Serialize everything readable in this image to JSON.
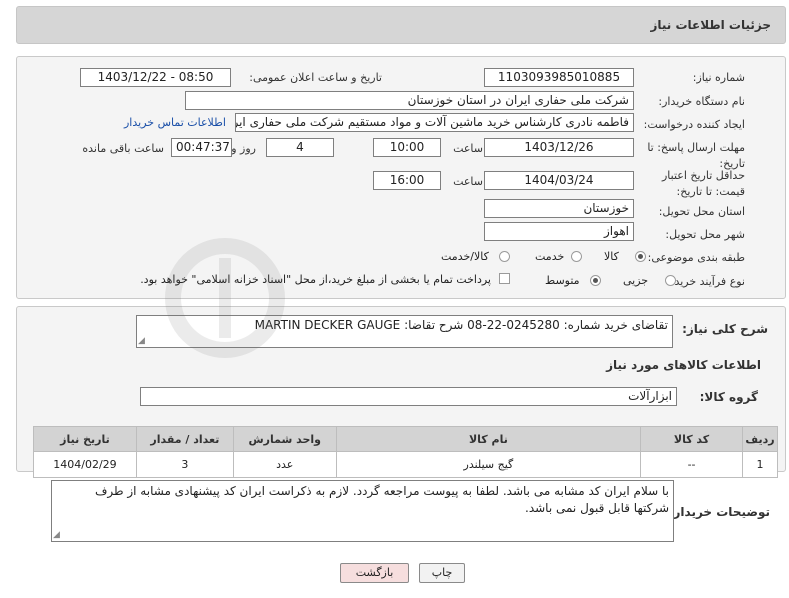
{
  "header": {
    "title": "جزئیات اطلاعات نیاز"
  },
  "form": {
    "need_number_label": "شماره نیاز:",
    "need_number": "1103093985010885",
    "announce_label": "تاریخ و ساعت اعلان عمومی:",
    "announce_value": "1403/12/22 - 08:50",
    "buyer_org_label": "نام دستگاه خریدار:",
    "buyer_org": "شرکت ملی حفاری ایران در استان خوزستان",
    "requester_label": "ایجاد کننده درخواست:",
    "requester": "فاطمه نادری کارشناس خرید ماشین آلات و مواد مستقیم شرکت ملی حفاری ایران",
    "buyer_contact_link": "اطلاعات تماس خریدار",
    "reply_deadline_label": "مهلت ارسال پاسخ: تا تاریخ:",
    "reply_date": "1403/12/26",
    "time_label": "ساعت",
    "reply_time": "10:00",
    "days_value": "4",
    "days_label": "روز و",
    "remaining_time": "00:47:37",
    "remaining_label": "ساعت باقی مانده",
    "price_validity_label": "حداقل تاریخ اعتبار قیمت: تا تاریخ:",
    "price_date": "1404/03/24",
    "price_time": "16:00",
    "province_label": "استان محل تحویل:",
    "province": "خوزستان",
    "city_label": "شهر محل تحویل:",
    "city": "اهواز",
    "category_label": "طبقه بندی موضوعی:",
    "category_options": [
      "کالا",
      "خدمت",
      "کالا/خدمت"
    ],
    "process_label": "نوع فرآیند خرید :",
    "process_options": [
      "جزیی",
      "متوسط"
    ],
    "payment_text": "پرداخت تمام یا بخشی از مبلغ خرید،از محل \"اسناد خزانه اسلامی\" خواهد بود."
  },
  "summary": {
    "label": "شرح کلی نیاز:",
    "text": "تقاضای خرید شماره: 0245280-22-08 شرح تقاضا: MARTIN DECKER GAUGE"
  },
  "goods_section_title": "اطلاعات کالاهای مورد نیاز",
  "goods_group": {
    "label": "گروه کالا:",
    "value": "ابزارآلات"
  },
  "goods_table": {
    "headers": [
      "ردیف",
      "کد کالا",
      "نام کالا",
      "واحد شمارش",
      "تعداد / مقدار",
      "تاریخ نیاز"
    ],
    "rows": [
      [
        "1",
        "--",
        "گیج سیلندر",
        "عدد",
        "3",
        "1404/02/29"
      ]
    ]
  },
  "buyer_notes": {
    "label": "توضیحات خریدار:",
    "text": "با سلام ایران کد مشابه می باشد. لطفا به پیوست مراجعه گردد. لازم به ذکراست ایران کد پیشنهادی مشابه از طرف شرکتها قابل قبول نمی باشد."
  },
  "buttons": {
    "print": "چاپ",
    "back": "بازگشت"
  },
  "colors": {
    "back_button_bg": "#f6dede",
    "link": "#1a4fa8",
    "header_bg": "#d6d6d6"
  }
}
